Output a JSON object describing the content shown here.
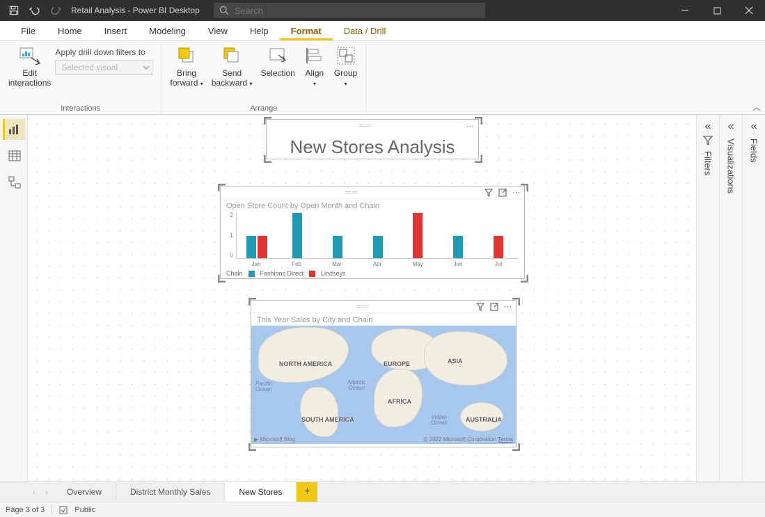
{
  "titlebar": {
    "title": "Retail Analysis - Power BI Desktop",
    "search_placeholder": "Search"
  },
  "menu": {
    "items": [
      "File",
      "Home",
      "Insert",
      "Modeling",
      "View",
      "Help",
      "Format",
      "Data / Drill"
    ],
    "active": "Format"
  },
  "ribbon": {
    "interactions": {
      "edit_btn": "Edit\ninteractions",
      "apply_label": "Apply drill down filters to",
      "apply_value": "Selected visual",
      "group_label": "Interactions"
    },
    "arrange": {
      "bring_forward": "Bring\nforward",
      "send_backward": "Send\nbackward",
      "selection": "Selection",
      "align": "Align",
      "group": "Group",
      "group_label": "Arrange"
    }
  },
  "right_panels": [
    "Filters",
    "Visualizations",
    "Fields"
  ],
  "canvas": {
    "title_visual": {
      "text": "New Stores Analysis"
    },
    "bar_visual": {
      "title": "Open Store Count by Open Month and Chain",
      "legend_label": "Chain",
      "series_names": [
        "Fashions Direct",
        "Lindseys"
      ]
    },
    "map_visual": {
      "title": "This Year Sales by City and Chain",
      "continents": {
        "na": "NORTH AMERICA",
        "sa": "SOUTH AMERICA",
        "eu": "EUROPE",
        "af": "AFRICA",
        "as": "ASIA",
        "au": "AUSTRALIA"
      },
      "oceans": {
        "pacific": "Pacific\nOcean",
        "atlantic": "Atlantic\nOcean",
        "indian": "Indian\nOcean"
      },
      "attribution": "Microsoft Bing",
      "copyright": "© 2022 Microsoft Corporation",
      "terms": "Terms"
    }
  },
  "chart_data": {
    "type": "bar",
    "title": "Open Store Count by Open Month and Chain",
    "categories": [
      "Jan",
      "Feb",
      "Mar",
      "Apr",
      "May",
      "Jun",
      "Jul"
    ],
    "series": [
      {
        "name": "Fashions Direct",
        "color": "#1f9bb6",
        "values": [
          1,
          2,
          1,
          1,
          0,
          1,
          0
        ]
      },
      {
        "name": "Lindseys",
        "color": "#e03531",
        "values": [
          1,
          0,
          0,
          0,
          2,
          0,
          1
        ]
      }
    ],
    "ylabel": "",
    "xlabel": "",
    "ylim": [
      0,
      2
    ],
    "yticks": [
      0,
      1,
      2
    ]
  },
  "page_tabs": {
    "tabs": [
      "Overview",
      "District Monthly Sales",
      "New Stores"
    ],
    "active": "New Stores"
  },
  "status": {
    "page": "Page 3 of 3",
    "sensitivity": "Public"
  }
}
